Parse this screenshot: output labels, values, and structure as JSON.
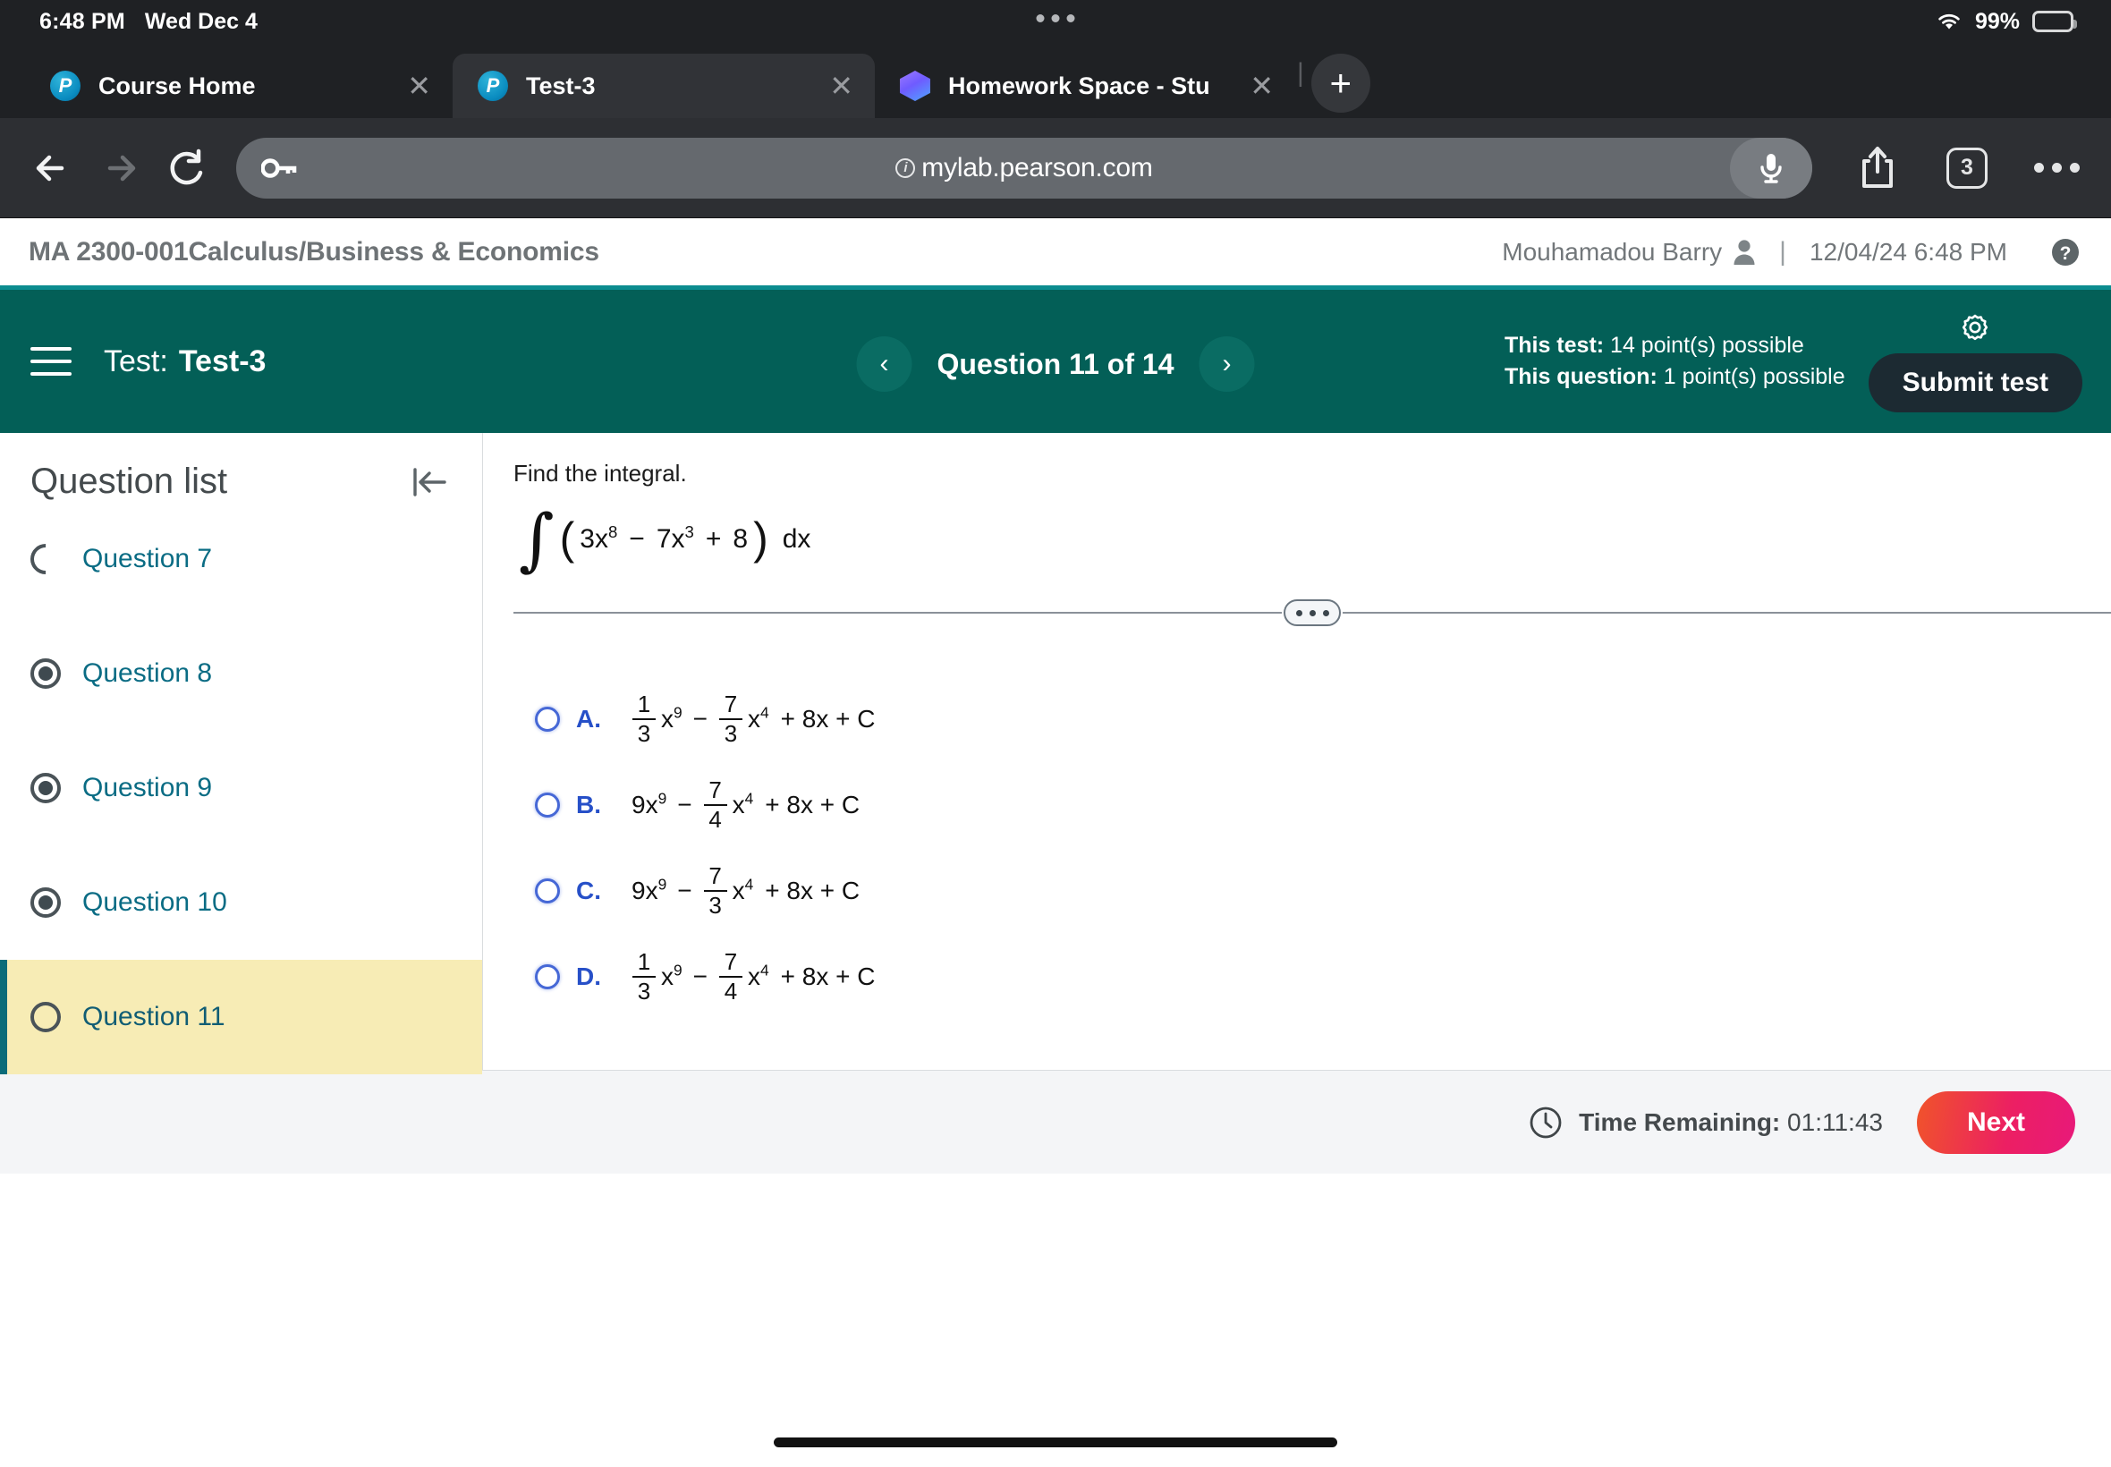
{
  "status_bar": {
    "time": "6:48 PM",
    "date": "Wed Dec 4",
    "battery_percent": "99%",
    "wifi_icon": "wifi-icon",
    "battery_icon": "battery-icon"
  },
  "browser": {
    "tabs": [
      {
        "title": "Course Home",
        "favicon": "pearson-favicon",
        "active": false
      },
      {
        "title": "Test-3",
        "favicon": "pearson-favicon",
        "active": true
      },
      {
        "title": "Homework Space - Stu",
        "favicon": "homework-space-favicon",
        "active": false
      }
    ],
    "close_glyph": "✕",
    "new_tab_glyph": "+",
    "tab_separator": "|",
    "toolbar": {
      "back_icon": "back-arrow-icon",
      "forward_icon": "forward-arrow-icon",
      "reload_icon": "reload-icon",
      "key_icon": "passwords-key-icon",
      "url": "mylab.pearson.com",
      "info_glyph": "i",
      "mic_icon": "microphone-icon",
      "share_icon": "share-icon",
      "tab_count": "3",
      "more_icon": "more-dots-icon"
    }
  },
  "course_header": {
    "course": "MA 2300-001Calculus/Business & Economics",
    "user": "Mouhamadou Barry",
    "user_icon": "user-avatar-icon",
    "divider": "|",
    "timestamp": "12/04/24 6:48 PM",
    "help_icon": "help-icon",
    "accent_color": "#0b8c8f"
  },
  "test_bar": {
    "menu_icon": "hamburger-menu-icon",
    "test_prefix": "Test:",
    "test_name": "Test-3",
    "prev_glyph": "‹",
    "next_glyph": "›",
    "question_counter": "Question 11 of 14",
    "this_test_label": "This test:",
    "this_test_value": "14 point(s) possible",
    "this_question_label": "This question:",
    "this_question_value": "1 point(s) possible",
    "gear_icon": "settings-gear-icon",
    "submit_label": "Submit test",
    "background_color": "#035f57"
  },
  "sidebar": {
    "title": "Question list",
    "collapse_icon": "collapse-panel-icon",
    "items": [
      {
        "label": "Question 7",
        "state": "partial"
      },
      {
        "label": "Question 8",
        "state": "done"
      },
      {
        "label": "Question 9",
        "state": "done"
      },
      {
        "label": "Question 10",
        "state": "done"
      },
      {
        "label": "Question 11",
        "state": "empty",
        "current": true
      }
    ],
    "highlight_color": "#f7ecb5"
  },
  "question": {
    "prompt": "Find the integral.",
    "integral_sign": "∫",
    "integrand": {
      "open_paren": "(",
      "term1_coef": "3x",
      "term1_exp": "8",
      "op1": "−",
      "term2_coef": "7x",
      "term2_exp": "3",
      "op2": "+",
      "term3": "8",
      "close_paren": ")",
      "differential": "dx"
    },
    "splitter_handle_icon": "resize-handle-dots-icon",
    "choices": [
      {
        "letter": "A.",
        "lead": "",
        "frac1_num": "1",
        "frac1_den": "3",
        "var1": "x",
        "exp1": "9",
        "op": "−",
        "frac2_num": "7",
        "frac2_den": "3",
        "var2": "x",
        "exp2": "4",
        "tail": "+ 8x + C",
        "selected": false
      },
      {
        "letter": "B.",
        "lead": "9x",
        "lead_exp": "9",
        "frac1_num": "",
        "frac1_den": "",
        "var1": "",
        "exp1": "",
        "op": "−",
        "frac2_num": "7",
        "frac2_den": "4",
        "var2": "x",
        "exp2": "4",
        "tail": "+ 8x + C",
        "selected": false
      },
      {
        "letter": "C.",
        "lead": "9x",
        "lead_exp": "9",
        "frac1_num": "",
        "frac1_den": "",
        "var1": "",
        "exp1": "",
        "op": "−",
        "frac2_num": "7",
        "frac2_den": "3",
        "var2": "x",
        "exp2": "4",
        "tail": "+ 8x + C",
        "selected": false
      },
      {
        "letter": "D.",
        "lead": "",
        "frac1_num": "1",
        "frac1_den": "3",
        "var1": "x",
        "exp1": "9",
        "op": "−",
        "frac2_num": "7",
        "frac2_den": "4",
        "var2": "x",
        "exp2": "4",
        "tail": "+ 8x + C",
        "selected": false
      }
    ]
  },
  "bottom_bar": {
    "clock_icon": "clock-icon",
    "time_label": "Time Remaining:",
    "time_value": "01:11:43",
    "next_label": "Next"
  }
}
